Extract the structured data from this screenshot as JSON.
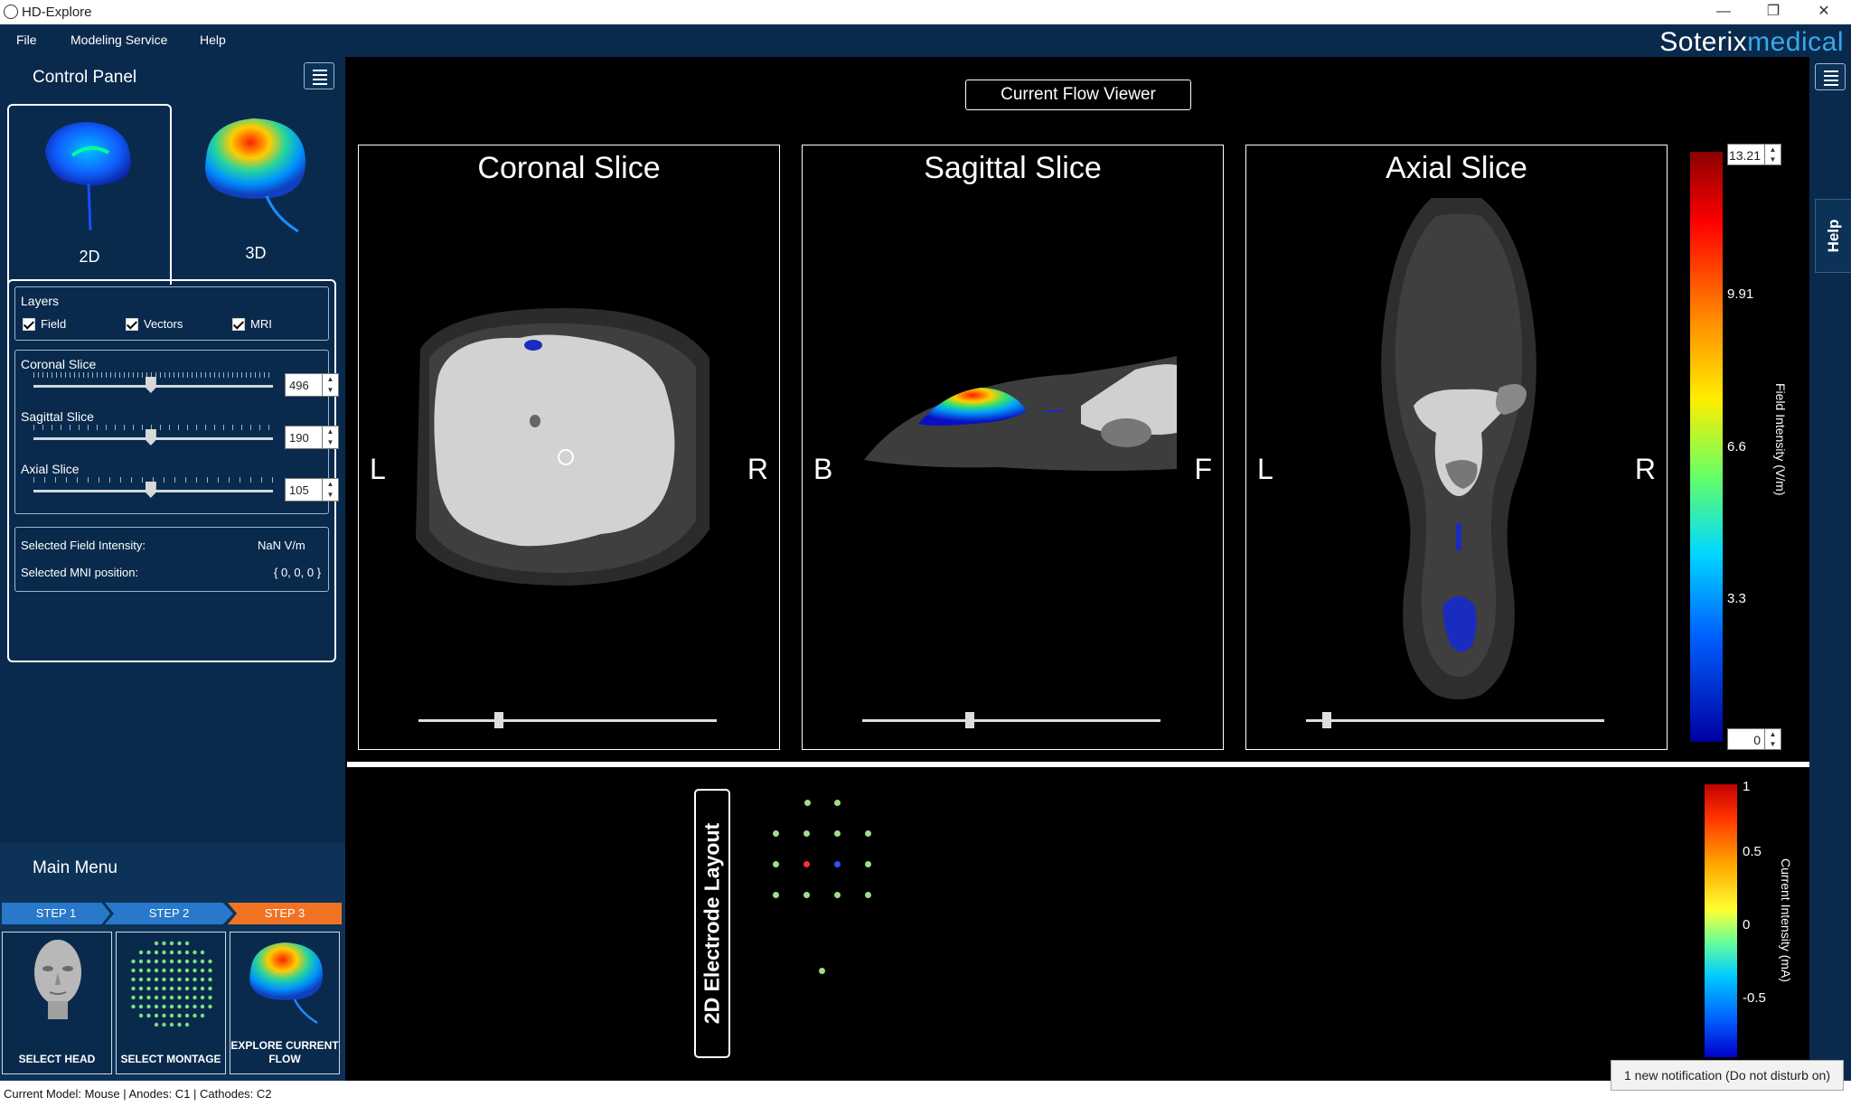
{
  "window": {
    "title": "HD-Explore",
    "minimize": "—",
    "maximize": "❐",
    "close": "✕"
  },
  "menu": {
    "file": "File",
    "modeling": "Modeling Service",
    "help": "Help"
  },
  "brand": {
    "part1": "Soterix",
    "part2": "medical"
  },
  "control_panel": {
    "title": "Control Panel",
    "tabs": {
      "tab_2d": "2D",
      "tab_3d": "3D"
    },
    "layers": {
      "title": "Layers",
      "field": "Field",
      "vectors": "Vectors",
      "mri": "MRI"
    },
    "sliders": {
      "coronal": {
        "label": "Coronal Slice",
        "value": "496",
        "position": 0.49
      },
      "sagittal": {
        "label": "Sagittal Slice",
        "value": "190",
        "position": 0.49
      },
      "axial": {
        "label": "Axial Slice",
        "value": "105",
        "position": 0.49
      }
    },
    "info": {
      "field_label": "Selected Field Intensity:",
      "field_value": "NaN V/m",
      "mni_label": "Selected MNI position:",
      "mni_value": "{ 0, 0, 0 }"
    }
  },
  "main_menu": {
    "title": "Main Menu",
    "steps": [
      "STEP 1",
      "STEP 2",
      "STEP 3"
    ],
    "cards": {
      "head": "SELECT HEAD",
      "montage": "SELECT MONTAGE",
      "explore": "EXPLORE CURRENT FLOW"
    }
  },
  "status": "Current Model: Mouse  |  Anodes: C1  |  Cathodes: C2",
  "viewer": {
    "title": "Current Flow Viewer",
    "coronal": {
      "title": "Coronal Slice",
      "left": "L",
      "right": "R",
      "slider": 0.27
    },
    "sagittal": {
      "title": "Sagittal Slice",
      "left": "B",
      "right": "F",
      "slider": 0.36
    },
    "axial": {
      "title": "Axial Slice",
      "left": "L",
      "right": "R",
      "slider": 0.07
    }
  },
  "field_colorbar": {
    "title": "Field Intensity (V/m)",
    "max": "13.21",
    "min": "0",
    "ticks": [
      "9.91",
      "6.6",
      "3.3"
    ]
  },
  "electrode": {
    "title": "2D Electrode Layout",
    "colorbar_title": "Current Intensity (mA)",
    "ticks": [
      "1",
      "0.5",
      "0",
      "-0.5"
    ]
  },
  "help_tab": "Help",
  "notification": "1 new notification (Do not disturb on)",
  "colors": {
    "panel": "#0a2a4d",
    "step_active": "#f07323",
    "step_inactive": "#2879c9",
    "accent": "#3aa7ea"
  }
}
